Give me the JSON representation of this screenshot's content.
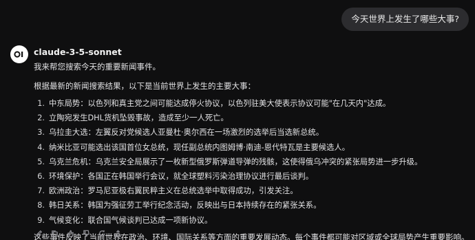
{
  "user_message": "今天世界上发生了哪些大事?",
  "assistant": {
    "model_name": "claude-3-5-sonnet",
    "intro": "我来帮您搜索今天的重要新闻事件。",
    "lead": "根据最新的新闻搜索结果，以下是当前世界上发生的主要大事：",
    "items": [
      {
        "num": "1.",
        "text": "中东局势：以色列和真主党之间可能达成停火协议，以色列驻美大使表示协议可能\"在几天内\"达成。"
      },
      {
        "num": "2.",
        "text": "立陶宛发生DHL货机坠毁事故，造成至少一人死亡。"
      },
      {
        "num": "3.",
        "text": "乌拉圭大选：左翼反对党候选人亚曼杜·奥尔西在一场激烈的选举后当选新总统。"
      },
      {
        "num": "4.",
        "text": "纳米比亚可能选出该国首位女总统，现任副总统内图姆博·南迪-恩代特瓦是主要候选人。"
      },
      {
        "num": "5.",
        "text": "乌克兰危机：乌克兰安全局展示了一枚新型俄罗斯弹道导弹的残骸，这使得俄乌冲突的紧张局势进一步升级。"
      },
      {
        "num": "6.",
        "text": "环境保护：各国正在韩国举行会议，就全球塑料污染治理协议进行最后谈判。"
      },
      {
        "num": "7.",
        "text": "欧洲政治：罗马尼亚极右翼民粹主义在总统选举中取得成功，引发关注。"
      },
      {
        "num": "8.",
        "text": "韩日关系：韩国为强征劳工举行纪念活动，反映出与日本持续存在的紧张关系。"
      },
      {
        "num": "9.",
        "text": "气候变化：联合国气候谈判已达成一项新协议。"
      }
    ],
    "summary": "这些事件反映了当前世界在政治、环境、国际关系等方面的重要发展动态。每个事件都可能对区域或全球局势产生重要影响。"
  },
  "actions": [
    "edit-icon",
    "copy-icon",
    "thumbs-up-icon",
    "thumbs-down-icon",
    "refresh-icon",
    "share-icon"
  ]
}
